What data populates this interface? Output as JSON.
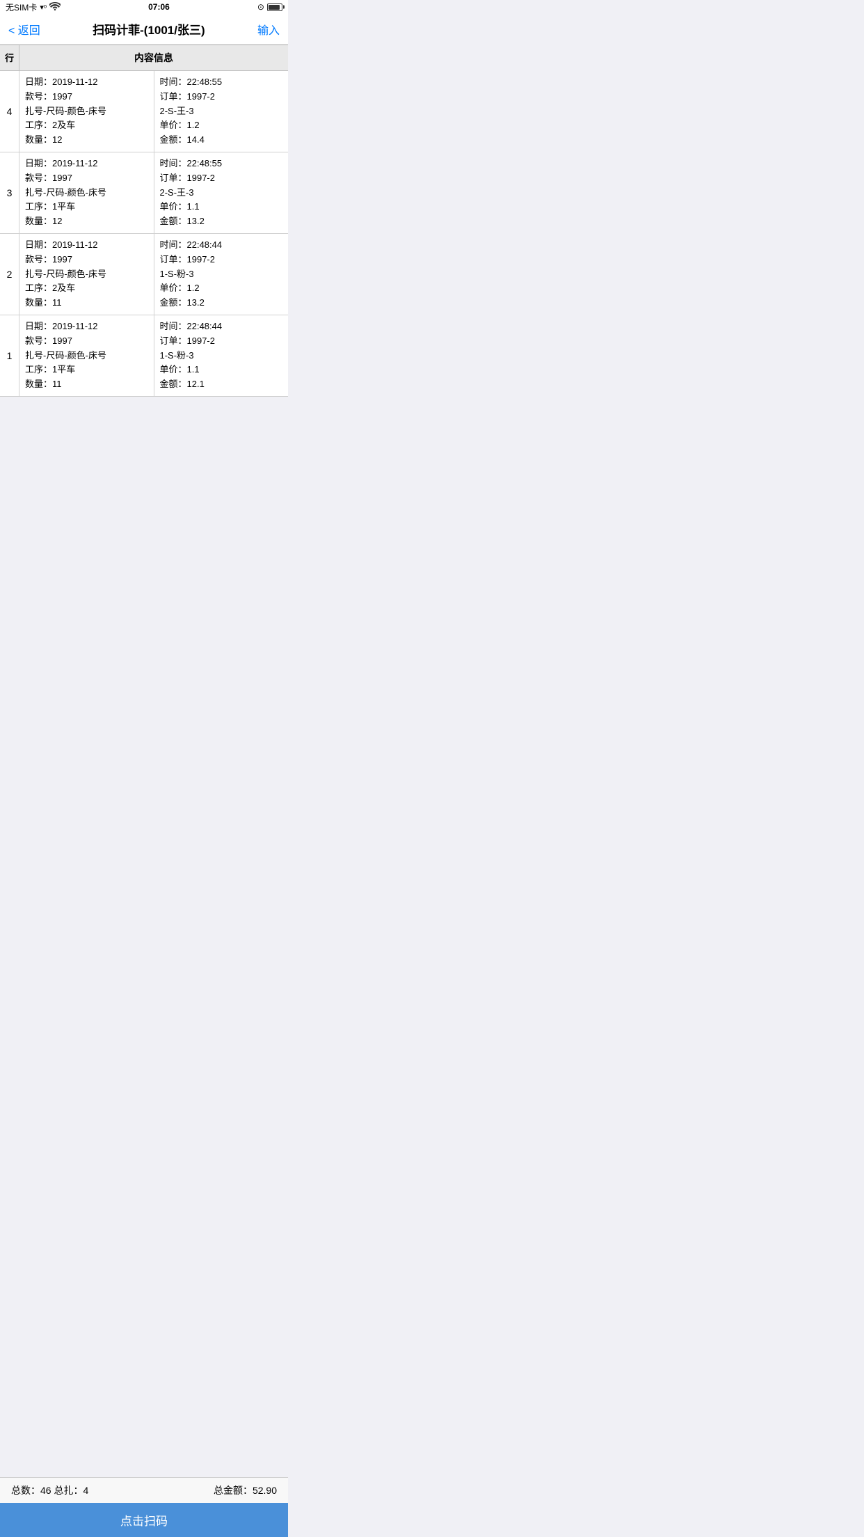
{
  "statusBar": {
    "carrier": "无SIM卡",
    "time": "07:06",
    "lockIcon": "⊕"
  },
  "navBar": {
    "backLabel": "< 返回",
    "title": "扫码计菲-(1001/张三)",
    "actionLabel": "输入"
  },
  "tableHeader": {
    "colRow": "行",
    "colContent": "内容信息"
  },
  "rows": [
    {
      "rowNum": "4",
      "leftLines": [
        "日期：2019-11-12",
        "款号：1997",
        "扎号-尺码-颜色-床号",
        "工序：2及车",
        "数量：12"
      ],
      "rightLines": [
        "时间：22:48:55",
        "订单：1997-2",
        "2-S-王-3",
        "单价：1.2",
        "金额：14.4"
      ]
    },
    {
      "rowNum": "3",
      "leftLines": [
        "日期：2019-11-12",
        "款号：1997",
        "扎号-尺码-颜色-床号",
        "工序：1平车",
        "数量：12"
      ],
      "rightLines": [
        "时间：22:48:55",
        "订单：1997-2",
        "2-S-王-3",
        "单价：1.1",
        "金额：13.2"
      ]
    },
    {
      "rowNum": "2",
      "leftLines": [
        "日期：2019-11-12",
        "款号：1997",
        "扎号-尺码-颜色-床号",
        "工序：2及车",
        "数量：11"
      ],
      "rightLines": [
        "时间：22:48:44",
        "订单：1997-2",
        "1-S-粉-3",
        "单价：1.2",
        "金额：13.2"
      ]
    },
    {
      "rowNum": "1",
      "leftLines": [
        "日期：2019-11-12",
        "款号：1997",
        "扎号-尺码-颜色-床号",
        "工序：1平车",
        "数量：11"
      ],
      "rightLines": [
        "时间：22:48:44",
        "订单：1997-2",
        "1-S-粉-3",
        "单价：1.1",
        "金额：12.1"
      ]
    }
  ],
  "footer": {
    "statsLeft": "总数：46 总扎：4",
    "statsRight": "总金额：52.90",
    "buttonLabel": "点击扫码"
  }
}
